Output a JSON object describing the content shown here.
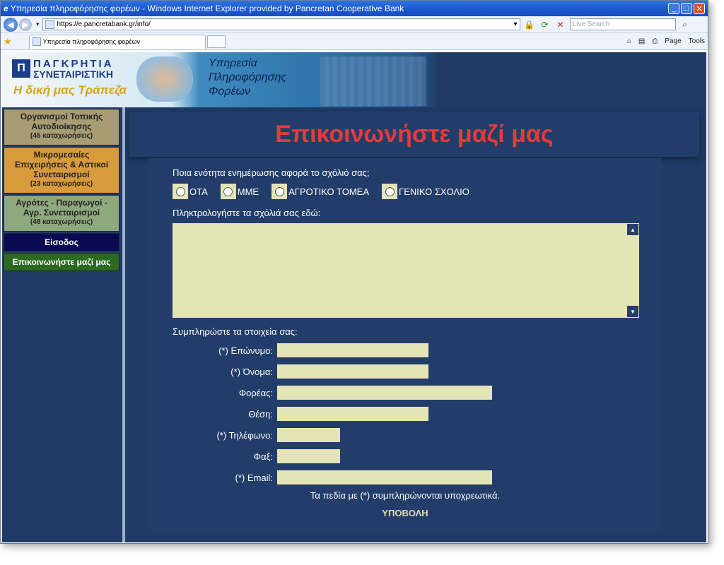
{
  "window": {
    "title": "Υπηρεσία πληροφόρησης φορέων - Windows Internet Explorer provided by Pancretan Cooperative Bank",
    "url": "https://e.pancretabank.gr/info/",
    "search_placeholder": "Live Search",
    "tab_title": "Υπηρεσία πληροφόρησης φορέων",
    "cmd_page": "Page",
    "cmd_tools": "Tools"
  },
  "banner": {
    "logo_line1": "ΠΑΓΚΡΗΤΙΑ",
    "logo_line2": "ΣΥΝΕΤΑΙΡΙΣΤΙΚΗ",
    "logo_slogan": "Η δική μας Τράπεζα",
    "service_line1": "Υπηρεσία",
    "service_line2": "Πληροφόρησης",
    "service_line3": "Φορέων"
  },
  "sidebar": {
    "items": [
      {
        "label": "Οργανισμοί Τοπικής Αυτοδιοίκησης",
        "count": "(45 καταχωρήσεις)"
      },
      {
        "label": "Μικρομεσαίες Επιχειρήσεις & Αστικοί Συνεταιρισμοί",
        "count": "(23 καταχωρήσεις)"
      },
      {
        "label": "Αγρότες - Παραγωγοί - Αγρ. Συνεταιρισμοί",
        "count": "(48 καταχωρήσεις)"
      },
      {
        "label": "Είσοδος"
      },
      {
        "label": "Επικοινωνήστε μαζί μας"
      }
    ]
  },
  "form": {
    "heading": "Επικοινωνήστε μαζί μας",
    "question": "Ποια ενότητα ενημέρωσης αφορά το σχόλιό σας;",
    "options": [
      "ΟΤΑ",
      "ΜΜΕ",
      "ΑΓΡΟΤΙΚΟ ΤΟΜΕΑ",
      "ΓΕΝΙΚΟ ΣΧΟΛΙΟ"
    ],
    "comment_prompt": "Πληκτρολογήστε τα σχόλιά σας εδώ:",
    "details_header": "Συμπληρώστε τα στοιχεία σας:",
    "fields": [
      {
        "label": "(*) Επώνυμο:"
      },
      {
        "label": "(*) Όνομα:"
      },
      {
        "label": "Φορέας:"
      },
      {
        "label": "Θέση:"
      },
      {
        "label": "(*) Τηλέφωνο:"
      },
      {
        "label": "Φαξ:"
      },
      {
        "label": "(*) Email:"
      }
    ],
    "required_note": "Τα πεδία με (*) συμπληρώνονται υποχρεωτικά.",
    "submit_label": "ΥΠΟΒΟΛΗ"
  },
  "colors": {
    "page_bg": "#1f3b66",
    "heading_red": "#e83a3a",
    "input_bg": "#e5e4b6"
  }
}
